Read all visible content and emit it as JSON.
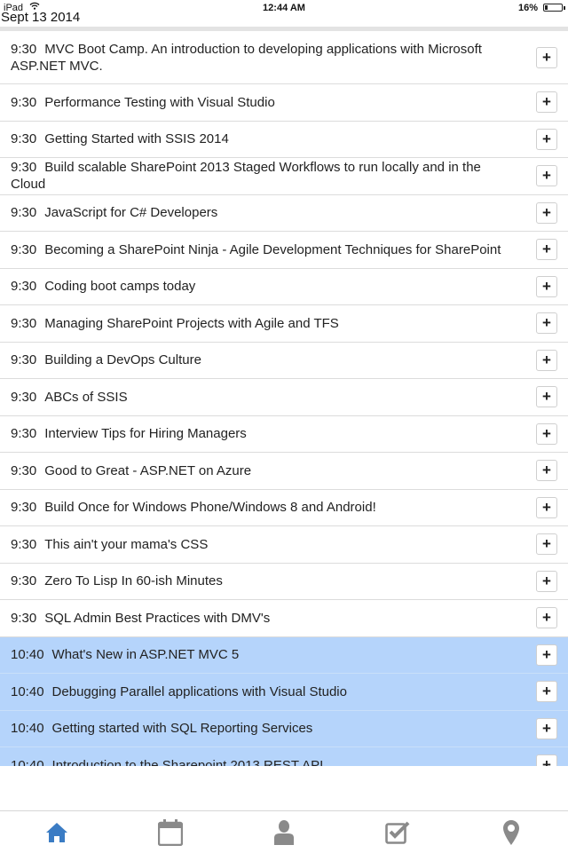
{
  "status_bar": {
    "carrier": "iPad",
    "time": "12:44 AM",
    "battery": "16%",
    "battery_level": 0.16
  },
  "date_label": "Sept 13 2014",
  "sessions": [
    {
      "time": "9:30",
      "title": "MVC Boot Camp. An introduction to developing applications with Microsoft ASP.NET MVC.",
      "highlight": false,
      "lines": 2
    },
    {
      "time": "9:30",
      "title": "Performance Testing with Visual Studio",
      "highlight": false,
      "lines": 1
    },
    {
      "time": "9:30",
      "title": "Getting Started with SSIS 2014",
      "highlight": false,
      "lines": 1
    },
    {
      "time": "9:30",
      "title": "Build scalable SharePoint 2013 Staged Workflows to run locally and in the Cloud",
      "highlight": false,
      "lines": 1
    },
    {
      "time": "9:30",
      "title": "JavaScript for C# Developers",
      "highlight": false,
      "lines": 1
    },
    {
      "time": "9:30",
      "title": "Becoming a SharePoint Ninja - Agile Development Techniques for SharePoint",
      "highlight": false,
      "lines": 1
    },
    {
      "time": "9:30",
      "title": "Coding boot camps today",
      "highlight": false,
      "lines": 1
    },
    {
      "time": "9:30",
      "title": "Managing SharePoint Projects with Agile and TFS",
      "highlight": false,
      "lines": 1
    },
    {
      "time": "9:30",
      "title": "Building a DevOps Culture",
      "highlight": false,
      "lines": 1
    },
    {
      "time": "9:30",
      "title": "ABCs of SSIS",
      "highlight": false,
      "lines": 1
    },
    {
      "time": "9:30",
      "title": "Interview Tips for Hiring Managers",
      "highlight": false,
      "lines": 1
    },
    {
      "time": "9:30",
      "title": "Good to Great - ASP.NET on Azure",
      "highlight": false,
      "lines": 1
    },
    {
      "time": "9:30",
      "title": "Build Once for Windows Phone/Windows 8 and Android!",
      "highlight": false,
      "lines": 1
    },
    {
      "time": "9:30",
      "title": "This ain't your mama's CSS",
      "highlight": false,
      "lines": 1
    },
    {
      "time": "9:30",
      "title": "Zero To Lisp In 60-ish Minutes",
      "highlight": false,
      "lines": 1
    },
    {
      "time": "9:30",
      "title": "SQL Admin Best Practices with DMV's",
      "highlight": false,
      "lines": 1
    },
    {
      "time": "10:40",
      "title": "What's New in ASP.NET MVC 5",
      "highlight": true,
      "lines": 1
    },
    {
      "time": "10:40",
      "title": "Debugging Parallel applications with Visual Studio",
      "highlight": true,
      "lines": 1
    },
    {
      "time": "10:40",
      "title": "Getting started with SQL Reporting Services",
      "highlight": true,
      "lines": 1
    },
    {
      "time": "10:40",
      "title": "Introduction to the Sharepoint 2013 REST API",
      "highlight": true,
      "lines": 1
    }
  ],
  "add_button_label": "+",
  "tabs": [
    {
      "name": "home-icon",
      "active": true
    },
    {
      "name": "calendar-icon",
      "active": false
    },
    {
      "name": "person-icon",
      "active": false
    },
    {
      "name": "checkbox-icon",
      "active": false
    },
    {
      "name": "map-pin-icon",
      "active": false
    }
  ],
  "colors": {
    "highlight_row": "#b5d4fb",
    "tab_active": "#3b7cc4",
    "tab_inactive": "#8a8a8a"
  }
}
